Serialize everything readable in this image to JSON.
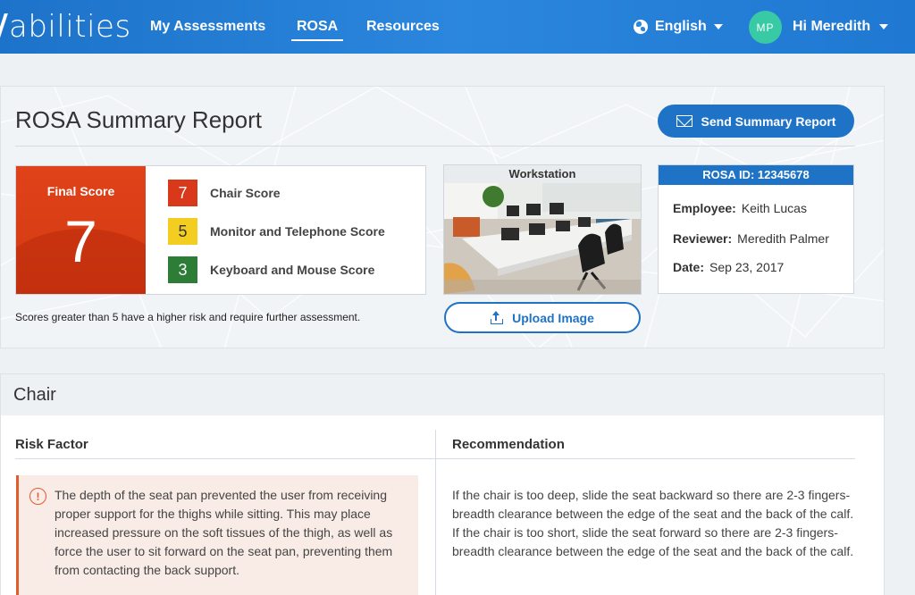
{
  "header": {
    "logo": "abilities",
    "nav": [
      {
        "label": "My Assessments",
        "active": false
      },
      {
        "label": "ROSA",
        "active": true
      },
      {
        "label": "Resources",
        "active": false
      }
    ],
    "language": "English",
    "user_initials": "MP",
    "greeting": "Hi Meredith"
  },
  "summary": {
    "title": "ROSA Summary Report",
    "send_label": "Send Summary Report",
    "final_label": "Final Score",
    "final_value": "7",
    "scores": [
      {
        "value": "7",
        "label": "Chair Score",
        "color": "#d9391a"
      },
      {
        "value": "5",
        "label": "Monitor and Telephone Score",
        "color": "#f3cd1f"
      },
      {
        "value": "3",
        "label": "Keyboard and Mouse Score",
        "color": "#2e7d36"
      }
    ],
    "note": "Scores greater than 5 have a higher risk and require further assessment.",
    "workstation_label": "Workstation",
    "upload_label": "Upload Image",
    "rosa_id": "ROSA ID: 12345678",
    "employee_label": "Employee:",
    "employee": "Keith Lucas",
    "reviewer_label": "Reviewer:",
    "reviewer": "Meredith Palmer",
    "date_label": "Date:",
    "date": "Sep 23, 2017"
  },
  "chair": {
    "title": "Chair",
    "risk_header": "Risk Factor",
    "rec_header": "Recommendation",
    "risk_text": "The depth of the seat pan prevented the user from receiving proper support for the thighs while sitting. This may place increased pressure on the soft tissues of the thigh, as well as force the user to sit forward on the seat pan, preventing them from contacting the back support.",
    "rec_text": "If the chair is too deep, slide the seat backward so there are 2-3 fingers-breadth clearance between the edge of the seat and the back of the calf. If the chair is too short, slide the seat forward so there are 2-3 fingers-breadth clearance between the edge of the seat and the back of the calf."
  }
}
